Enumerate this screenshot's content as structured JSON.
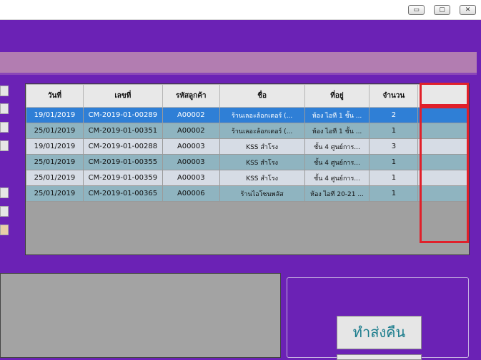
{
  "window": {
    "minimize_glyph": "▭",
    "maximize_glyph": "▢",
    "close_glyph": "✕"
  },
  "grid": {
    "columns": [
      "วันที่",
      "เลขที่",
      "รหัสลูกค้า",
      "ชื่อ",
      "ที่อยู่",
      "จำนวน",
      ""
    ],
    "rows": [
      [
        "19/01/2019",
        "CM-2019-01-00289",
        "A00002",
        "ร้านเลอะล้อกเตอร์ (...",
        "ห้อง ไอที 1 ชั้น ...",
        "2",
        ""
      ],
      [
        "25/01/2019",
        "CM-2019-01-00351",
        "A00002",
        "ร้านเลอะล้อกเตอร์ (...",
        "ห้อง ไอที 1 ชั้น ...",
        "1",
        ""
      ],
      [
        "19/01/2019",
        "CM-2019-01-00288",
        "A00003",
        "KSS สำโรง",
        "ชั้น 4 ศูนย์การ...",
        "3",
        ""
      ],
      [
        "25/01/2019",
        "CM-2019-01-00355",
        "A00003",
        "KSS สำโรง",
        "ชั้น 4 ศูนย์การ...",
        "1",
        ""
      ],
      [
        "25/01/2019",
        "CM-2019-01-00359",
        "A00003",
        "KSS สำโรง",
        "ชั้น 4 ศูนย์การ...",
        "1",
        ""
      ],
      [
        "25/01/2019",
        "CM-2019-01-00365",
        "A00006",
        "ร้านไอโซนพลัส",
        "ห้อง ไอที 20-21 ...",
        "1",
        ""
      ]
    ],
    "selected_row": 0
  },
  "actions": {
    "return_label": "ทำส่งคืน"
  },
  "colors": {
    "background": "#6b22b5",
    "header_bar": "#b27db1",
    "selected_row": "#2f7fd6",
    "highlight": "#e0202a"
  }
}
